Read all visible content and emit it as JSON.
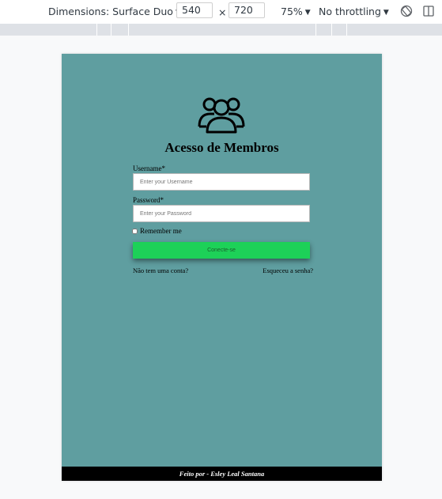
{
  "toolbar": {
    "device_label": "Dimensions: Surface Duo",
    "width": "540",
    "separator": "×",
    "height": "720",
    "zoom": "75%",
    "throttling": "No throttling",
    "icons": [
      "rotate-icon",
      "dock-icon"
    ]
  },
  "page": {
    "background": "#5f9ea0",
    "icon": "users-group-icon",
    "title": "Acesso de Membros",
    "username_label": "Username*",
    "username_placeholder": "Enter your Username",
    "password_label": "Password*",
    "password_placeholder": "Enter your Password",
    "remember_label": "Remember me",
    "login_button": "Conecte-se",
    "login_button_color": "#1dd158",
    "signup_link": "Não tem uma conta?",
    "forgot_link": "Esqueceu a senha?",
    "footer": "Feito por - Esley Leal Santana"
  }
}
